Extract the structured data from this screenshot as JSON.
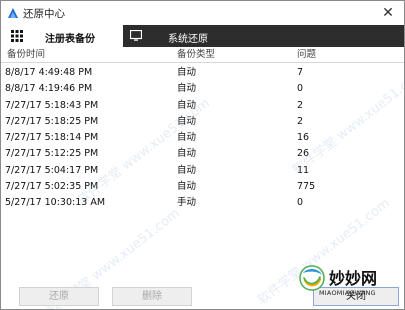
{
  "window": {
    "title": "还原中心",
    "close_glyph": "✕"
  },
  "tabs": [
    {
      "label": "注册表备份",
      "icon": "grid-icon",
      "active": true
    },
    {
      "label": "系统还原",
      "icon": "monitor-icon",
      "active": false
    }
  ],
  "table": {
    "headers": [
      "备份时间",
      "备份类型",
      "问题"
    ],
    "rows": [
      {
        "time": "8/8/17 4:49:48 PM",
        "type": "自动",
        "issues": "7"
      },
      {
        "time": "8/8/17 4:19:46 PM",
        "type": "自动",
        "issues": "0"
      },
      {
        "time": "7/27/17 5:18:43 PM",
        "type": "自动",
        "issues": "2"
      },
      {
        "time": "7/27/17 5:18:25 PM",
        "type": "自动",
        "issues": "2"
      },
      {
        "time": "7/27/17 5:18:14 PM",
        "type": "自动",
        "issues": "16"
      },
      {
        "time": "7/27/17 5:12:25 PM",
        "type": "自动",
        "issues": "26"
      },
      {
        "time": "7/27/17 5:04:17 PM",
        "type": "自动",
        "issues": "11"
      },
      {
        "time": "7/27/17 5:02:35 PM",
        "type": "自动",
        "issues": "775"
      },
      {
        "time": "5/27/17 10:30:13 AM",
        "type": "手动",
        "issues": "0"
      }
    ]
  },
  "buttons": {
    "restore": "还原",
    "delete": "删除",
    "close": "关闭"
  },
  "watermark": {
    "diagonal_text": "软件学堂 www.xue51.com",
    "logo_text": "妙妙网",
    "logo_subtext": "MIAOMIAOWANG"
  },
  "colors": {
    "tab_bar": "#2d2d2d",
    "active_tab": "#ffffff",
    "disabled_text": "#a8a8a8"
  }
}
